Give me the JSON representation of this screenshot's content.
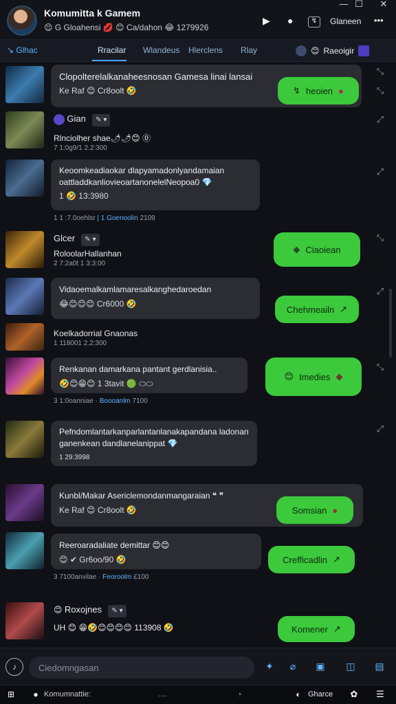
{
  "window": {
    "title": "Komumitta k Gamem",
    "subtitle": "😌 G Gloahensi 💋 😊 Ca/dahon 😂 1279926",
    "controls": [
      "—",
      "☐",
      "✕"
    ],
    "actions": {
      "play": "▶",
      "circle": "●",
      "tag": "Glaneen",
      "more": "•••"
    }
  },
  "tabs": {
    "search": "Glhac",
    "items": [
      "Rracilar",
      "Wlandeus",
      "Hlerclens",
      "Rlay"
    ],
    "right_label": "Raeoigir"
  },
  "messages": [
    {
      "text": "Clopolterelalkanaheesnosan Gamesa linai lansai",
      "meta": "Ke Raf 😊 Cr8oolt 🤣"
    },
    {
      "sender": "Gian",
      "tag": "✎ ▾",
      "text": "Rlnciolher shae🌶🌶😊 ⓪",
      "time": "7 1:0g9/1 2.2:300"
    },
    {
      "text": "Keoomkeadiaokar dlapyamadonlyandamaian oattladdkanliovieoartanonelelNeopoa0 💎",
      "meta": "1 🤣 13:3980"
    },
    {
      "time_a": "1 1 :7.0oehlsr ",
      "time_hl": "| 1 Goenoolin",
      "time_b": " 2109"
    },
    {
      "sender": "Glcer",
      "tag": "✎ ▾",
      "text": "RoloolarHallanhan",
      "time": "2 7:2a0t 1 3:3:00"
    },
    {
      "text": "Vidaoemalkamlamaresalkanghedaroedan",
      "meta": "😂😊😊😊 Cr6000 🤣"
    },
    {
      "text": "Koelkadorrial Gnaonas",
      "time": "1 118001 2.2:300"
    },
    {
      "text": "Renkanan damarkana pantant gerdlanisia..",
      "meta": "🤣😊😁😊 1 3tavit 🟢 ⬭⬭"
    },
    {
      "time_a": "3 1:0oanniae · ",
      "time_hl": "Boooanlm",
      "time_b": " 7100"
    },
    {
      "text": "Pefndomlantarkanparlantanlanakapandana ladonan ganenkean dandlanelanippat 💎",
      "meta": "1 29:3998"
    },
    {
      "text": "Kunbl/Makar Asericlemondanmangaraian ❝ ❞",
      "meta": "Ke Raf 😊 Cr8oolt 🤣"
    },
    {
      "text": "Reeroaradaliate demittar 😊😊",
      "meta": "😊 ✔ Gr6oo/90 🤣"
    },
    {
      "time_a": "3 7100anvilae · ",
      "time_hl": "Feoroolm",
      "time_b": " £100"
    },
    {
      "sender": "Roxojnes",
      "tag": "✎ ▾",
      "text": "UH 😊 😁🤣😊😊😊😊 113908 🤣"
    }
  ],
  "green_bubbles": [
    {
      "label": "heoien",
      "icon_left": "↯",
      "icon_right": "●"
    },
    {
      "label": "Ciaoiean",
      "icon_left": "◆"
    },
    {
      "label": "Chehmeailn",
      "icon_right": "↗"
    },
    {
      "label": "Imedies",
      "icon_left": "😊",
      "icon_right": "◆"
    },
    {
      "label": "Somsian",
      "icon_right": "●"
    },
    {
      "label": "Crefficadlin",
      "icon_right": "↗"
    },
    {
      "label": "Komener",
      "icon_right": "↗"
    }
  ],
  "input": {
    "placeholder": "Ciedomngasan"
  },
  "taskbar": {
    "app_label": "Komumnattie:",
    "middle": "....",
    "right_label": "Gharce"
  },
  "colors": {
    "accent": "#4aa3ff",
    "green_bubble": "#3cc93c",
    "bubble": "#2b2d33",
    "background": "#0f1116"
  }
}
